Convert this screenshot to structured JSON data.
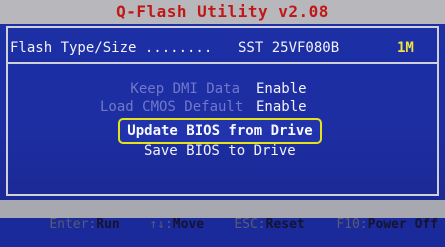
{
  "title": "Q-Flash Utility v2.08",
  "flash": {
    "label": "Flash Type/Size ........",
    "value": "SST 25VF080B",
    "size": "1M"
  },
  "options": [
    {
      "label": "Keep DMI Data",
      "value": "Enable"
    },
    {
      "label": "Load CMOS Default",
      "value": "Enable"
    }
  ],
  "menu": {
    "update": "Update BIOS from Drive",
    "save": "Save BIOS to Drive"
  },
  "status": [
    {
      "key": "Enter:",
      "action": "Run"
    },
    {
      "key": "↑↓:",
      "action": "Move"
    },
    {
      "key": "ESC:",
      "action": "Reset"
    },
    {
      "key": "F10:",
      "action": "Power Off"
    }
  ],
  "colors": {
    "background": "#1c2fa6",
    "title": "#c01818",
    "highlight_border": "#e6e21a",
    "size_text": "#f0e040"
  }
}
